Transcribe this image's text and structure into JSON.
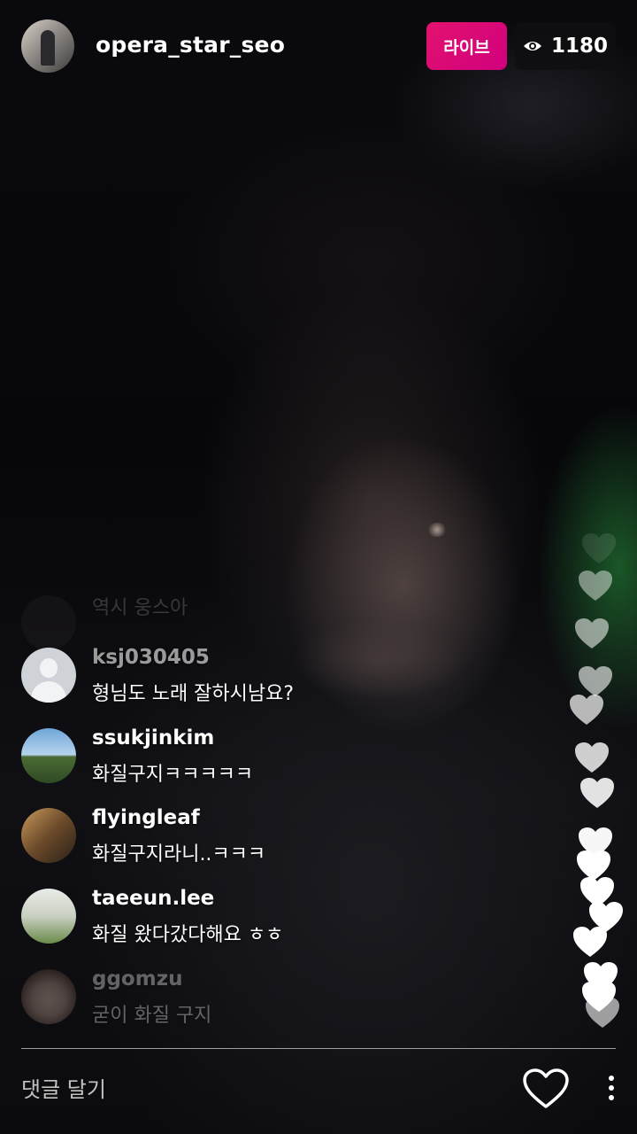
{
  "header": {
    "host_username": "opera_star_seo",
    "live_label": "라이브",
    "viewer_count": "1180",
    "viewer_icon": "eye-icon",
    "live_color": "#d8097a"
  },
  "comments": [
    {
      "username": "",
      "text": "역시 웅스아",
      "avatar": "dark-avatar"
    },
    {
      "username": "ksj030405",
      "text": "형님도 노래 잘하시남요?",
      "avatar": "default-avatar"
    },
    {
      "username": "ssukjinkim",
      "text": "화질구지ㅋㅋㅋㅋㅋ",
      "avatar": "sky-field-avatar"
    },
    {
      "username": "flyingleaf",
      "text": "화질구지라니..ㅋㅋㅋ",
      "avatar": "room-avatar"
    },
    {
      "username": "taeeun.lee",
      "text": "화질 왔다갔다해요 ㅎㅎ",
      "avatar": "field-avatar"
    },
    {
      "username": "ggomzu",
      "text": "굳이 화질 구지",
      "avatar": "girl-avatar"
    }
  ],
  "footer": {
    "comment_placeholder": "댓글 달기",
    "like_icon": "heart-outline-icon",
    "more_icon": "more-vertical-icon"
  },
  "floating_hearts_count": 15
}
